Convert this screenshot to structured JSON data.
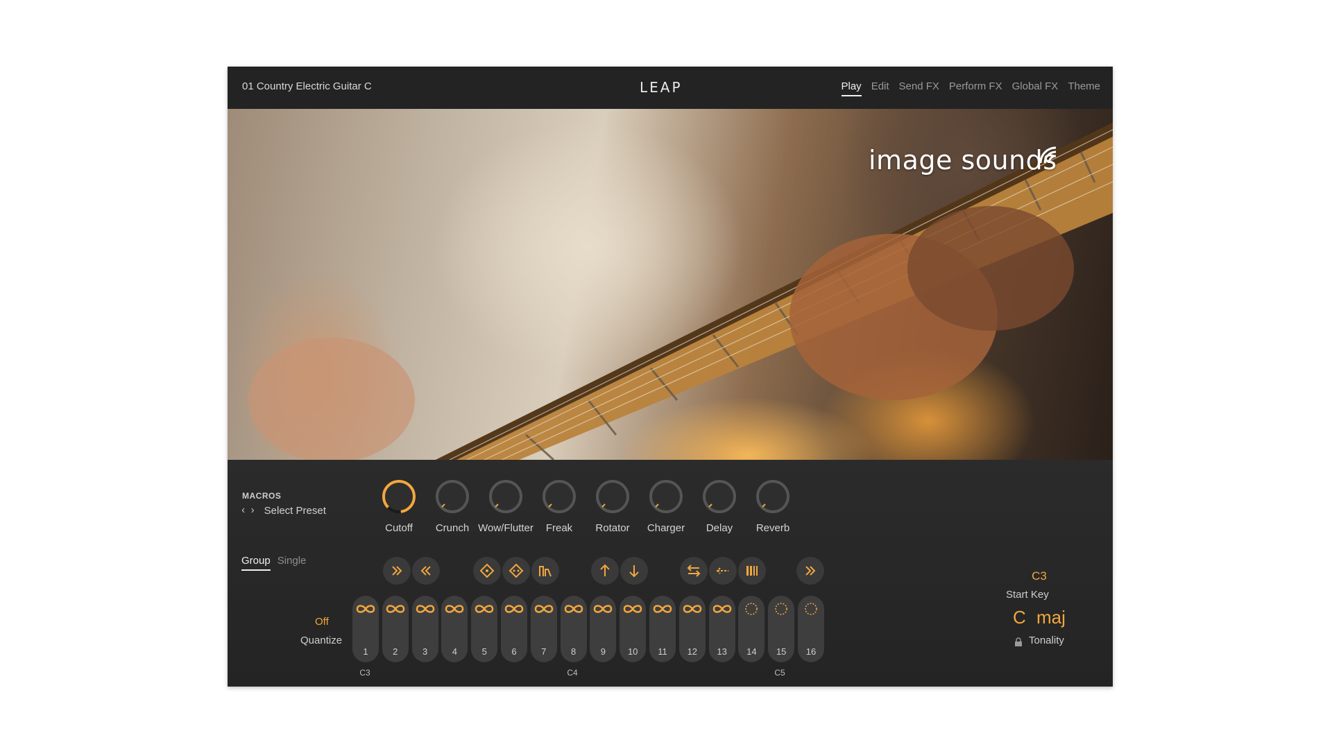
{
  "header": {
    "preset_name": "01 Country Electric Guitar C",
    "logo": "LEAP",
    "tabs": [
      {
        "label": "Play",
        "active": true
      },
      {
        "label": "Edit",
        "active": false
      },
      {
        "label": "Send FX",
        "active": false
      },
      {
        "label": "Perform FX",
        "active": false
      },
      {
        "label": "Global FX",
        "active": false
      },
      {
        "label": "Theme",
        "active": false
      }
    ]
  },
  "hero": {
    "brand": "image sounds"
  },
  "macros": {
    "title": "MACROS",
    "select_preset": "Select Preset",
    "knobs": [
      {
        "label": "Cutoff",
        "active": true
      },
      {
        "label": "Crunch",
        "active": false
      },
      {
        "label": "Wow/Flutter",
        "active": false
      },
      {
        "label": "Freak",
        "active": false
      },
      {
        "label": "Rotator",
        "active": false
      },
      {
        "label": "Charger",
        "active": false
      },
      {
        "label": "Delay",
        "active": false
      },
      {
        "label": "Reverb",
        "active": false
      }
    ]
  },
  "mode": {
    "group": "Group",
    "single": "Single",
    "active": "Group"
  },
  "quantize": {
    "value": "Off",
    "label": "Quantize"
  },
  "fx_buttons": [
    "fast-forward-icon",
    "rewind-icon",
    "dice-icon",
    "dice-alt-icon",
    "bars-icon",
    "arrow-up-icon",
    "arrow-down-icon",
    "reverse-icon",
    "stretch-icon",
    "stutter-icon",
    "skip-icon"
  ],
  "pads": [
    {
      "num": "1",
      "state": "loop"
    },
    {
      "num": "2",
      "state": "loop"
    },
    {
      "num": "3",
      "state": "loop"
    },
    {
      "num": "4",
      "state": "loop"
    },
    {
      "num": "5",
      "state": "loop"
    },
    {
      "num": "6",
      "state": "loop"
    },
    {
      "num": "7",
      "state": "loop"
    },
    {
      "num": "8",
      "state": "loop"
    },
    {
      "num": "9",
      "state": "loop"
    },
    {
      "num": "10",
      "state": "loop"
    },
    {
      "num": "11",
      "state": "loop"
    },
    {
      "num": "12",
      "state": "loop"
    },
    {
      "num": "13",
      "state": "loop"
    },
    {
      "num": "14",
      "state": "oneshot"
    },
    {
      "num": "15",
      "state": "oneshot"
    },
    {
      "num": "16",
      "state": "oneshot"
    }
  ],
  "octave_labels": [
    "C3",
    "C4",
    "C5"
  ],
  "start_key": {
    "value": "C3",
    "label": "Start Key"
  },
  "tonality": {
    "key": "C",
    "mode": "maj",
    "label": "Tonality"
  },
  "colors": {
    "accent": "#f2a73e",
    "panel": "#262626",
    "pad": "#3e3e3e"
  }
}
